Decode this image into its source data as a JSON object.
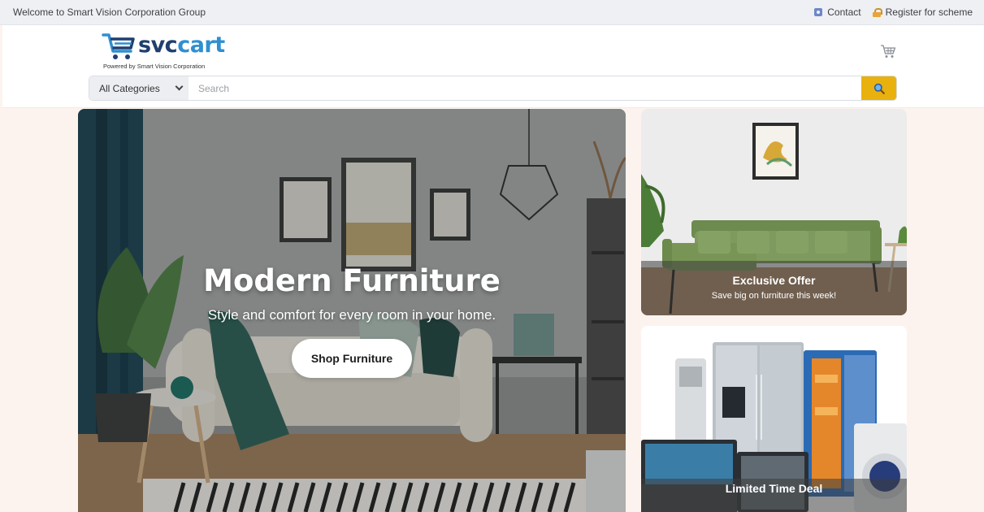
{
  "topbar": {
    "welcome": "Welcome to Smart Vision Corporation Group",
    "contact": "Contact",
    "register": "Register for scheme"
  },
  "header": {
    "logo_part1": "svc",
    "logo_part2": "cart",
    "logo_tagline": "Powered by Smart Vision Corporation",
    "cart_icon": "cart-icon"
  },
  "search": {
    "category": "All Categories",
    "placeholder": "Search",
    "value": "",
    "button_icon": "search-icon"
  },
  "hero": {
    "title": "Modern Furniture",
    "subtitle": "Style and comfort for every room in your home.",
    "button": "Shop Furniture"
  },
  "cards": [
    {
      "title": "Exclusive Offer",
      "subtitle": "Save big on furniture this week!"
    },
    {
      "title": "Limited Time Deal",
      "subtitle": ""
    }
  ],
  "colors": {
    "accent": "#e8b10e",
    "brand_dark": "#1f3f6e",
    "brand_light": "#2f8fd0",
    "page_bg": "#fdf3ee"
  }
}
